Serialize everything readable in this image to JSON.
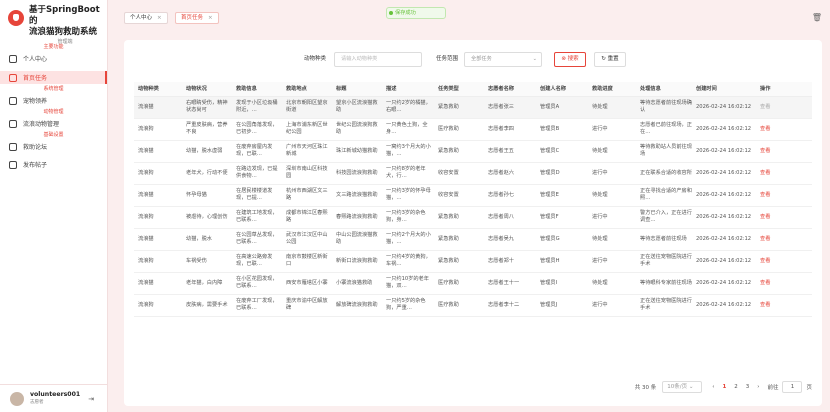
{
  "brand": {
    "title_line1": "基于SpringBoot的",
    "title_line2": "流浪猫狗救助系统",
    "subtitle": "管理端"
  },
  "sidebar": {
    "sections": [
      {
        "label": "主要功能",
        "items": [
          {
            "label": "个人中心"
          },
          {
            "label": "首页任务"
          }
        ]
      },
      {
        "label": "系统管理",
        "items": [
          {
            "label": "宠物领养"
          }
        ]
      },
      {
        "label": "动物管理",
        "items": [
          {
            "label": "流浪动物管理"
          }
        ]
      },
      {
        "label": "基础设置",
        "items": [
          {
            "label": "救助论坛"
          },
          {
            "label": "发布帖子"
          }
        ]
      }
    ]
  },
  "user": {
    "name": "volunteers001",
    "role": "志愿者"
  },
  "tabs": [
    {
      "label": "个人中心"
    },
    {
      "label": "首页任务"
    }
  ],
  "toast": "保存成功",
  "filters": {
    "animal_type_label": "动物种类",
    "animal_type_placeholder": "请输入动物种类",
    "task_range_label": "任务范围",
    "task_range_value": "全部任务",
    "search_label": "搜索",
    "reset_label": "重置"
  },
  "table": {
    "headers": [
      "动物种类",
      "动物状况",
      "救助信息",
      "救助地点",
      "标题",
      "描述",
      "任务类型",
      "志愿者名称",
      "创建人名称",
      "救助进度",
      "处理信息",
      "创建时间",
      "操作"
    ],
    "rows": [
      [
        "流浪猫",
        "右眼睛受伤，精神状态尚可",
        "发现于小区垃圾桶附近，…",
        "北京市朝阳区望京街道",
        "望京小区流浪猫救助",
        "一只约2岁的橘猫，右眼…",
        "紧急救助",
        "志愿者张三",
        "管理员A",
        "待处理",
        "等待志愿者前往现场确认",
        "2026-02-24 16:02:12",
        "查看"
      ],
      [
        "流浪狗",
        "严重皮肤病，营养不良",
        "在公园角落发现，已初步…",
        "上海市浦东新区世纪公园",
        "世纪公园流浪狗救助",
        "一只黄色土狗，全身…",
        "医疗救助",
        "志愿者李四",
        "管理员B",
        "进行中",
        "志愿者已前往现场，正在…",
        "2026-02-24 16:02:12",
        "查看"
      ],
      [
        "流浪猫",
        "幼猫，脱水虚弱",
        "在废弃房屋内发现，已联…",
        "广州市天河区珠江新城",
        "珠江新城幼猫救助",
        "一窝约3个月大的小猫，…",
        "紧急救助",
        "志愿者王五",
        "管理员C",
        "待处理",
        "等待救助站人员前往现场",
        "2026-02-24 16:02:12",
        "查看"
      ],
      [
        "流浪狗",
        "老年犬，行动不便",
        "在路边发现，已提供食物…",
        "深圳市南山区科技园",
        "科技园流浪狗救助",
        "一只约8岁的老年犬，行…",
        "收容安置",
        "志愿者赵六",
        "管理员D",
        "进行中",
        "正在联系合适的收容所",
        "2026-02-24 16:02:12",
        "查看"
      ],
      [
        "流浪猫",
        "怀孕母猫",
        "在居民楼楼道发现，已提…",
        "杭州市西湖区文三路",
        "文三路流浪猫救助",
        "一只约3岁的怀孕母猫，…",
        "收容安置",
        "志愿者孙七",
        "管理员E",
        "待处理",
        "正在寻找合适的产房和照…",
        "2026-02-24 16:02:12",
        "查看"
      ],
      [
        "流浪狗",
        "被虐待，心理创伤",
        "在建筑工地发现，已联系…",
        "成都市锦江区春熙路",
        "春熙路流浪狗救助",
        "一只约3岁的杂色狗，身…",
        "紧急救助",
        "志愿者周八",
        "管理员F",
        "进行中",
        "警方已介入，正在进行调查…",
        "2026-02-24 16:02:12",
        "查看"
      ],
      [
        "流浪猫",
        "幼猫，脱水",
        "在公园草丛发现，已联系…",
        "武汉市江汉区中山公园",
        "中山公园流浪猫救助",
        "一只约2个月大的小猫，…",
        "紧急救助",
        "志愿者吴九",
        "管理员G",
        "待处理",
        "等待志愿者前往现场",
        "2026-02-24 16:02:12",
        "查看"
      ],
      [
        "流浪狗",
        "车祸受伤",
        "在高速公路旁发现，已联…",
        "南京市鼓楼区新街口",
        "新街口流浪狗救助",
        "一只约4岁的黄狗，车祸…",
        "紧急救助",
        "志愿者郑十",
        "管理员H",
        "进行中",
        "正在送往宠物医院进行手术",
        "2026-02-24 16:02:12",
        "查看"
      ],
      [
        "流浪猫",
        "老年猫，白内障",
        "在小区花园发现，已联系…",
        "西安市雁塔区小寨",
        "小寨流浪猫救助",
        "一只约10岁的老年猫，双…",
        "医疗救助",
        "志愿者王十一",
        "管理员I",
        "待处理",
        "等待眼科专家前往现场",
        "2026-02-24 16:02:12",
        "查看"
      ],
      [
        "流浪狗",
        "皮肤病，需要手术",
        "在废弃工厂发现，已联系…",
        "重庆市渝中区解放碑",
        "解放碑流浪狗救助",
        "一只约5岁的杂色狗，严重…",
        "医疗救助",
        "志愿者李十二",
        "管理员J",
        "进行中",
        "正在送往宠物医院进行手术",
        "2026-02-24 16:02:12",
        "查看"
      ]
    ]
  },
  "pager": {
    "total": "共 30 条",
    "page_size": "10条/页",
    "pages": [
      "1",
      "2",
      "3"
    ],
    "goto_label": "前往",
    "goto_value": "1",
    "page_suffix": "页"
  }
}
